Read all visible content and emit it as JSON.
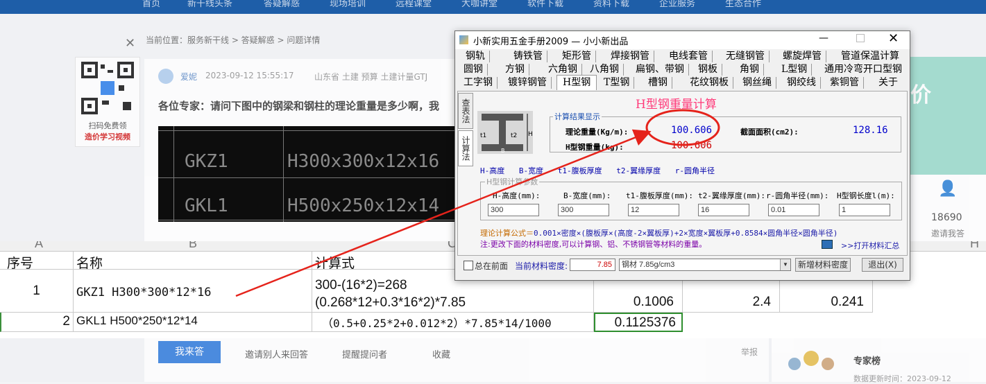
{
  "nav": [
    "首页",
    "新干线头条",
    "答疑解惑",
    "现场培训",
    "远程课堂",
    "大咖讲堂",
    "软件下载",
    "资料下载",
    "企业服务",
    "生态合作"
  ],
  "breadcrumb": "当前位置：服务新干线 > 答疑解惑 > 问题详情",
  "question": {
    "user": "爱妮",
    "time": "2023-09-12 15:55:17",
    "meta": "山东省 土建 预算 土建计量GTJ",
    "title": "各位专家：请问下图中的钢梁和钢柱的理论重量是多少啊，我"
  },
  "qr": {
    "line1": "扫码免费领",
    "line2": "造价学习视频"
  },
  "cad_rows": [
    {
      "name": "GKZ1",
      "spec": "H300x300x12x16"
    },
    {
      "name": "GKL1",
      "spec": "H500x250x12x14"
    }
  ],
  "right_panel": {
    "count": "18690",
    "invite": "邀请我答",
    "banner": "价"
  },
  "excel": {
    "col_letters": [
      "A",
      "B",
      "C",
      "H"
    ],
    "headers": {
      "seq": "序号",
      "name": "名称",
      "formula": "计算式"
    },
    "rows": [
      {
        "seq": "1",
        "name": "GKZ1  H300*300*12*16",
        "formula1": "300-(16*2)=268",
        "formula2": "(0.268*12+0.3*16*2)*7.85",
        "e": "0.1006",
        "f": "2.4",
        "g": "0.241"
      },
      {
        "seq": "2",
        "name": "GKL1  H500*250*12*14",
        "formula1": "（0.5+0.25*2+0.012*2）*7.85*14/1000",
        "e": "0.1125376"
      }
    ]
  },
  "bottom": {
    "answer_btn": "我来答",
    "invite": "邀请别人来回答",
    "remind": "提醒提问者",
    "collect": "收藏",
    "report": "举报",
    "expert": "专家榜",
    "update": "数据更新时间：2023-09-12"
  },
  "dialog": {
    "title": "小新实用五金手册2009 — 小小新出品",
    "tabs_row1": [
      "钢轨",
      "铸铁管",
      "矩形管",
      "焊接钢管",
      "电线套管",
      "无缝钢管",
      "螺旋焊管",
      "管道保温计算"
    ],
    "tabs_row2": [
      "圆钢",
      "方钢",
      "六角钢",
      "八角钢",
      "扁钢、带钢",
      "钢板",
      "角钢",
      "L型钢",
      "通用冷弯开口型钢"
    ],
    "tabs_row3": [
      "工字钢",
      "镀锌钢管",
      "H型钢",
      "T型钢",
      "槽钢",
      "花纹钢板",
      "钢丝绳",
      "钢绞线",
      "紫铜管",
      "关于"
    ],
    "side_tabs": [
      "查表法",
      "计算法"
    ],
    "heading": "H型钢重量计算",
    "result_group": "计算结果显示",
    "theory_label": "理论重量(Kg/m):",
    "theory_value": "100.606",
    "area_label": "截面面积(cm2):",
    "area_value": "128.16",
    "weight_label": "H型钢重量(kg):",
    "weight_value": "100.606",
    "legend": [
      "H-高度",
      "B-宽度",
      "t1-腹板厚度",
      "t2-翼缘厚度",
      "r-圆角半径"
    ],
    "param_group": "H型钢计算参数",
    "params": [
      {
        "label": "H-高度(mm):",
        "value": "300"
      },
      {
        "label": "B-宽度(mm):",
        "value": "300"
      },
      {
        "label": "t1-腹板厚度(mm):",
        "value": "12"
      },
      {
        "label": "t2-翼缘厚度(mm):",
        "value": "16"
      },
      {
        "label": "r-圆角半径(mm):",
        "value": "0.01"
      },
      {
        "label": "H型钢长度l(m):",
        "value": "1"
      }
    ],
    "formula_prefix": "理论计算公式＝",
    "formula_body": "0.001×密度×(腹板厚×(高度-2×翼板厚)+2×宽度×翼板厚+0.8584×圆角半径×圆角半径)",
    "note": "注:更改下面的材料密度,可以计算钢、铝、不锈钢管等材料的重量。",
    "open_material": ">>打开材料汇总",
    "always_top": "总在前面",
    "density_label": "当前材料密度:",
    "density_value": "7.85",
    "material_select": "钢材 7.85g/cm3",
    "add_density": "新增材料密度",
    "exit": "退出(X)",
    "colors": {
      "heading": "#ff3b7a",
      "value": "#0000cc",
      "weight": "#cc0000",
      "label_blue": "#0000aa",
      "annotation": "#e5231b"
    }
  }
}
